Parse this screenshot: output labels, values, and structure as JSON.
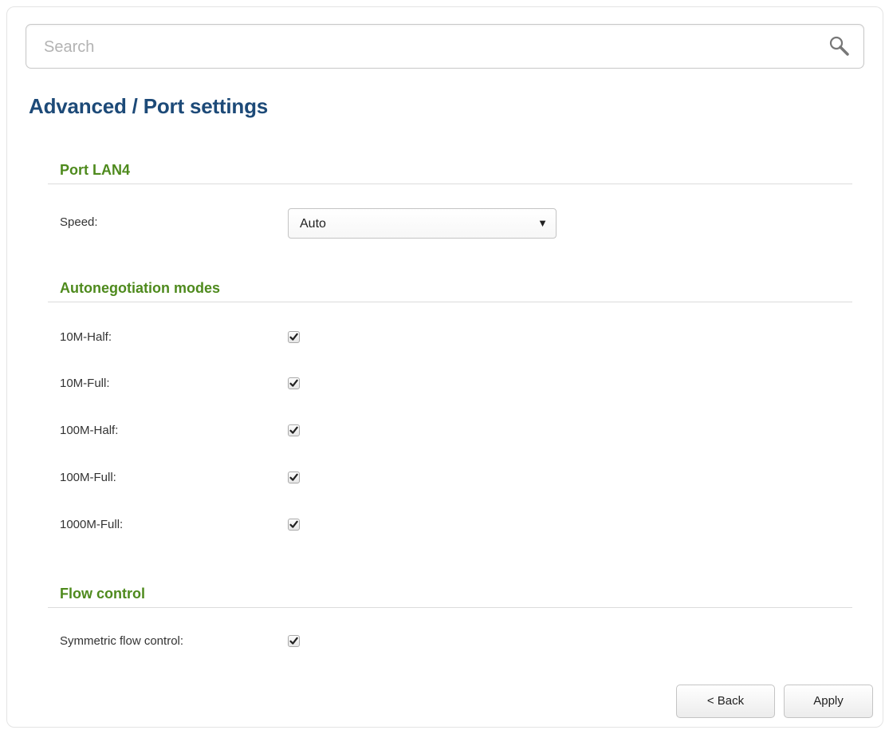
{
  "search": {
    "placeholder": "Search"
  },
  "header": {
    "title": "Advanced /  Port settings"
  },
  "port_section": {
    "title": "Port LAN4",
    "speed_label": "Speed:",
    "speed_value": "Auto"
  },
  "autoneg_section": {
    "title": "Autonegotiation modes",
    "items": [
      {
        "label": "10M-Half:",
        "checked": true
      },
      {
        "label": "10M-Full:",
        "checked": true
      },
      {
        "label": "100M-Half:",
        "checked": true
      },
      {
        "label": "100M-Full:",
        "checked": true
      },
      {
        "label": "1000M-Full:",
        "checked": true
      }
    ]
  },
  "flow_section": {
    "title": "Flow control",
    "items": [
      {
        "label": "Symmetric flow control:",
        "checked": true
      }
    ]
  },
  "buttons": {
    "back": "< Back",
    "apply": "Apply"
  },
  "colors": {
    "title": "#1d4a78",
    "section_title": "#4e8a1d"
  }
}
